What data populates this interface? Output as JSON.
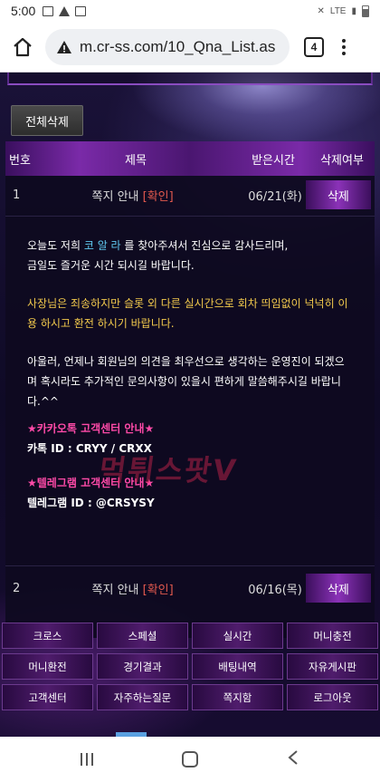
{
  "status_bar": {
    "time": "5:00",
    "right_text": "LTE"
  },
  "browser": {
    "url": "m.cr-ss.com/10_Qna_List.as",
    "tab_count": "4"
  },
  "toolbar": {
    "delete_all_label": "전체삭제"
  },
  "table": {
    "headers": [
      "번호",
      "제목",
      "받은시간",
      "삭제여부"
    ],
    "rows": [
      {
        "no": "1",
        "title": "쪽지 안내",
        "status": "[확인]",
        "date": "06/21(화)",
        "delete_label": "삭제"
      },
      {
        "no": "2",
        "title": "쪽지 안내",
        "status": "[확인]",
        "date": "06/16(목)",
        "delete_label": "삭제"
      }
    ]
  },
  "message": {
    "p1_pre": "오늘도 저희 ",
    "p1_brand": "코 알 라",
    "p1_post": " 를 찾아주셔서 진심으로 감사드리며,",
    "p1_line2": "금일도 즐거운 시간 되시길 바랍니다.",
    "p2": "사장님은 죄송하지만 슬롯 외 다른 실시간으로 회차 띄임없이 넉넉히 이용 하시고 환전 하시기 바랍니다.",
    "p3": "아울러, 언제나 회원님의 의견을 최우선으로 생각하는 운영진이 되겠으며 혹시라도 추가적인 문의사항이 있을시 편하게 말씀해주시길 바랍니다.^^",
    "kakao_title": "★카카오톡 고객센터 안내★",
    "kakao_id": "카톡 ID : CRYY / CRXX",
    "telegram_title": "★텔레그램 고객센터 안내★",
    "telegram_id": "텔레그램 ID : @CRSYSY"
  },
  "watermark": "먹튀스팟V",
  "menu": [
    "크로스",
    "스페셜",
    "실시간",
    "머니충전",
    "머니환전",
    "경기결과",
    "배팅내역",
    "자유게시판",
    "고객센터",
    "자주하는질문",
    "쪽지함",
    "로그아웃"
  ]
}
